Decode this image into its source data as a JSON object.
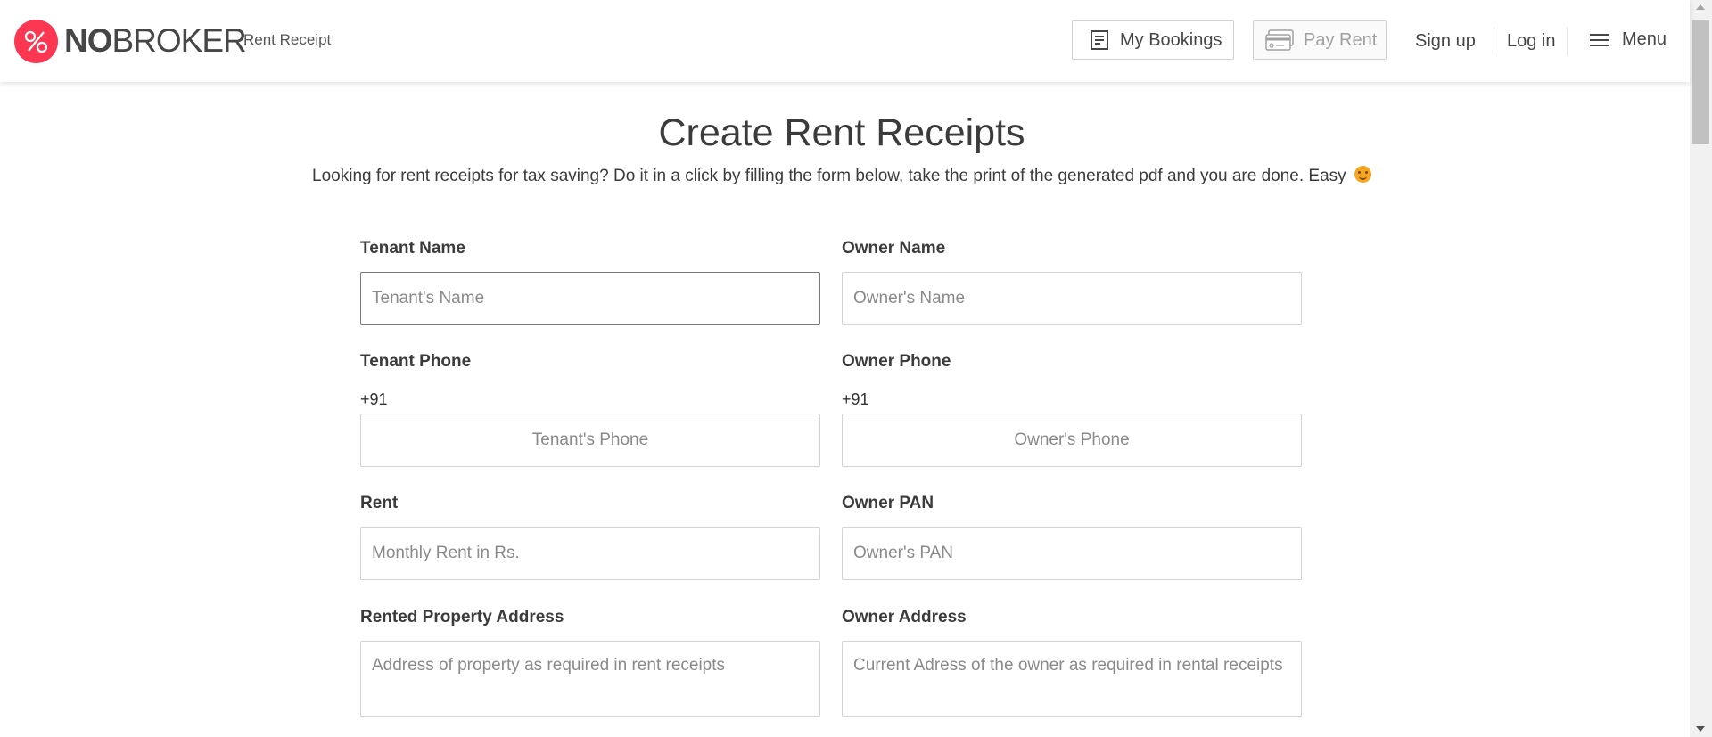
{
  "header": {
    "brand_bold": "NO",
    "brand_rest": "BROKER",
    "subtitle": "Rent Receipt",
    "bookings_label": "My Bookings",
    "payrent_label": "Pay Rent",
    "signup_label": "Sign up",
    "login_label": "Log in",
    "menu_label": "Menu"
  },
  "main": {
    "title": "Create Rent Receipts",
    "description": "Looking for rent receipts for tax saving? Do it in a click by filling the form below, take the print of the generated pdf and you are done. Easy"
  },
  "form": {
    "tenant_name": {
      "label": "Tenant Name",
      "placeholder": "Tenant's Name",
      "value": ""
    },
    "owner_name": {
      "label": "Owner Name",
      "placeholder": "Owner's Name",
      "value": ""
    },
    "tenant_phone": {
      "label": "Tenant Phone",
      "prefix": "+91",
      "placeholder": "Tenant's Phone",
      "value": ""
    },
    "owner_phone": {
      "label": "Owner Phone",
      "prefix": "+91",
      "placeholder": "Owner's Phone",
      "value": ""
    },
    "rent": {
      "label": "Rent",
      "placeholder": "Monthly Rent in Rs.",
      "value": ""
    },
    "owner_pan": {
      "label": "Owner PAN",
      "placeholder": "Owner's PAN",
      "value": ""
    },
    "property_address": {
      "label": "Rented Property Address",
      "placeholder": "Address of property as required in rent receipts",
      "value": ""
    },
    "owner_address": {
      "label": "Owner Address",
      "placeholder": "Current Adress of the owner as required in rental receipts",
      "value": ""
    }
  },
  "icons": {
    "logo": "nobroker-logo-icon",
    "bookings": "document-list-icon",
    "payrent": "credit-card-icon",
    "menu": "hamburger-menu-icon",
    "emoji": "smiling-face-icon"
  },
  "colors": {
    "brand": "#fd3752",
    "text": "#3b3b3b",
    "border": "#d3d3d3"
  }
}
